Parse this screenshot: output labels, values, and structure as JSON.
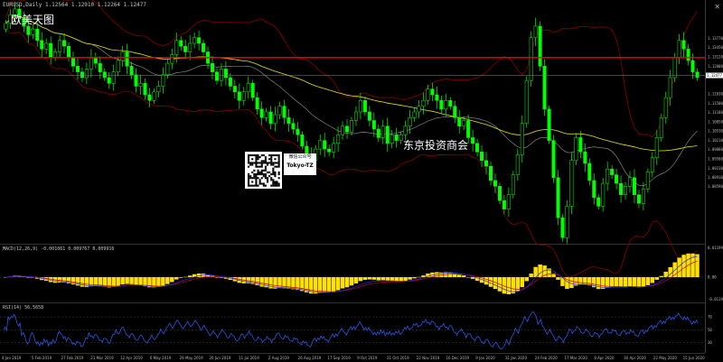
{
  "window": {
    "chart_title": "EURUSD,Daily  1.12564 1.12910 1.12264 1.12477",
    "close_icon": "close-icon"
  },
  "watermarks": {
    "top_left": "欧美天图",
    "center": "东京投资商会"
  },
  "qr_caption": {
    "line1": "微信公众号",
    "line2": "Tokyo-TZ"
  },
  "panes": {
    "macd_label": "MACD(12,26,9) -0.001061 0.009767 0.009916",
    "rsi_label": "RSI(14) 56.5658"
  },
  "colors": {
    "candle_bull": "#00ff00",
    "candle_bear": "#00ff00",
    "ma_fast": "#9a9a9a",
    "ma_slow": "#e6e600",
    "bollinger": "#8b0000",
    "level_line": "#ff0000",
    "macd_hist": "#ffe000",
    "macd_signal": "#c80000",
    "macd_line": "#1f2fff",
    "rsi_line": "#3060ff",
    "grid": "#2a2a2a"
  },
  "chart_data": {
    "type": "candlestick",
    "symbol": "EURUSD",
    "timeframe": "Daily",
    "x_labels": [
      "4 Jan 2019",
      "5 Feb 2019",
      "27 Feb 2019",
      "21 Mar 2019",
      "12 Apr 2019",
      "6 May 2019",
      "29 May 2019",
      "20 Jun 2019",
      "11 Jul 2019",
      "2 Aug 2019",
      "26 Aug 2019",
      "17 Sep 2019",
      "9 Oct 2019",
      "31 Oct 2019",
      "22 Nov 2019",
      "16 Dec 2019",
      "9 Jan 2020",
      "31 Jan 2020",
      "24 Feb 2020",
      "17 Mar 2020",
      "8 Apr 2020",
      "30 Apr 2020",
      "22 May 2020",
      "15 Jun 2020"
    ],
    "price_axis": [
      "1.13770",
      "1.13450",
      "1.13120",
      "1.12800",
      "1.12477",
      "1.11830",
      "1.11500",
      "1.11180",
      "1.10850",
      "1.10530",
      "1.10210",
      "1.09880",
      "1.09560",
      "1.09230",
      "1.08910",
      "1.08590"
    ],
    "current_price": "1.12477",
    "level_price": 1.131,
    "macd_axis": [
      "0.011993",
      "0.00",
      "-0.011993"
    ],
    "rsi_axis": [
      "70",
      "50",
      "30"
    ],
    "close": [
      1.143,
      1.146,
      1.148,
      1.145,
      1.142,
      1.139,
      1.141,
      1.137,
      1.134,
      1.136,
      1.131,
      1.133,
      1.137,
      1.135,
      1.131,
      1.128,
      1.126,
      1.124,
      1.127,
      1.131,
      1.129,
      1.126,
      1.124,
      1.122,
      1.126,
      1.13,
      1.133,
      1.128,
      1.125,
      1.121,
      1.122,
      1.118,
      1.116,
      1.119,
      1.121,
      1.125,
      1.129,
      1.132,
      1.137,
      1.135,
      1.133,
      1.136,
      1.138,
      1.136,
      1.133,
      1.129,
      1.126,
      1.123,
      1.127,
      1.124,
      1.121,
      1.119,
      1.116,
      1.119,
      1.122,
      1.117,
      1.113,
      1.11,
      1.112,
      1.108,
      1.111,
      1.114,
      1.11,
      1.108,
      1.106,
      1.104,
      1.1,
      1.097,
      1.095,
      1.099,
      1.102,
      1.099,
      1.098,
      1.101,
      1.104,
      1.107,
      1.105,
      1.109,
      1.112,
      1.116,
      1.112,
      1.109,
      1.106,
      1.103,
      1.107,
      1.101,
      1.104,
      1.102,
      1.104,
      1.107,
      1.11,
      1.112,
      1.114,
      1.116,
      1.12,
      1.118,
      1.116,
      1.113,
      1.116,
      1.114,
      1.11,
      1.107,
      1.109,
      1.103,
      1.101,
      1.098,
      1.095,
      1.093,
      1.088,
      1.086,
      1.081,
      1.078,
      1.083,
      1.09,
      1.097,
      1.108,
      1.123,
      1.138,
      1.142,
      1.128,
      1.113,
      1.102,
      1.089,
      1.075,
      1.068,
      1.079,
      1.095,
      1.103,
      1.098,
      1.094,
      1.088,
      1.082,
      1.079,
      1.087,
      1.092,
      1.09,
      1.087,
      1.083,
      1.086,
      1.089,
      1.083,
      1.08,
      1.085,
      1.091,
      1.096,
      1.103,
      1.11,
      1.117,
      1.124,
      1.131,
      1.137,
      1.134,
      1.13,
      1.126,
      1.124
    ]
  }
}
